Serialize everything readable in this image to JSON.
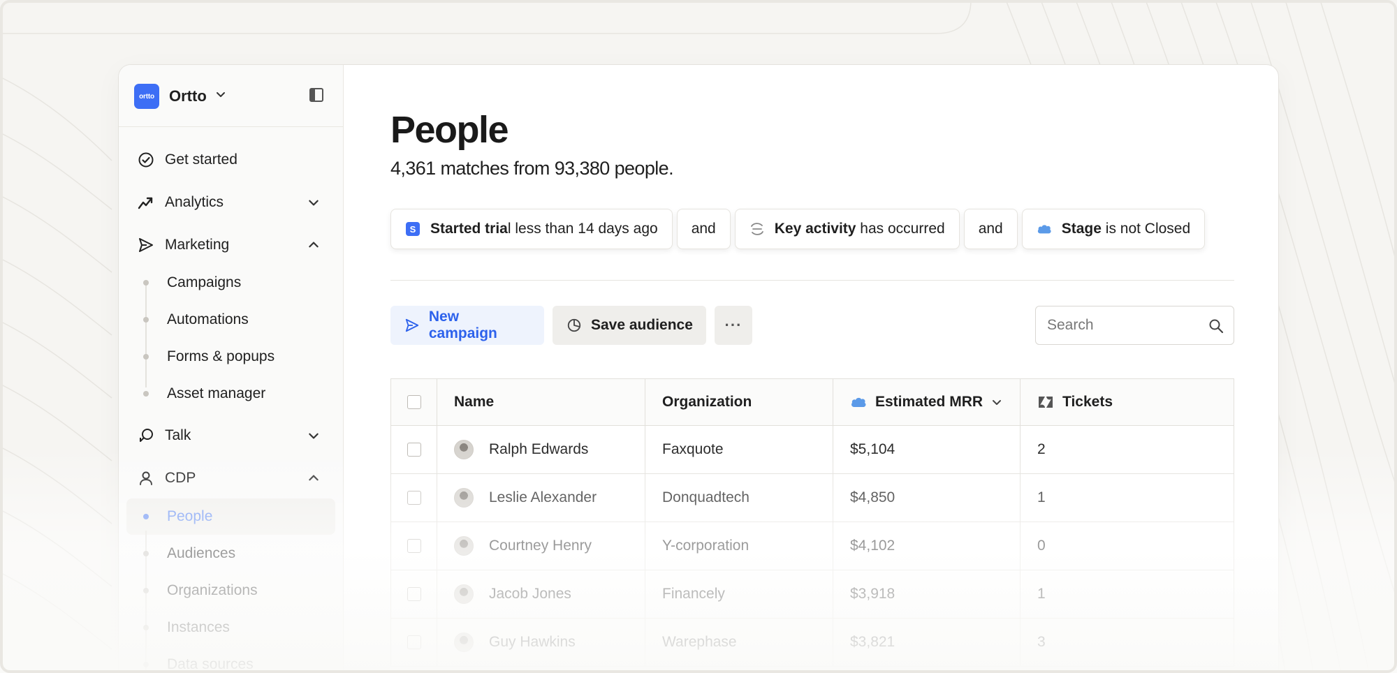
{
  "app": {
    "brand": "Ortto",
    "logo_text": "ortto",
    "accent": "#3d6ef5"
  },
  "sidebar": {
    "items": [
      {
        "label": "Get started",
        "icon": "check-circle-icon"
      },
      {
        "label": "Analytics",
        "icon": "trend-icon",
        "expanded": false
      },
      {
        "label": "Marketing",
        "icon": "send-icon",
        "expanded": true
      },
      {
        "label": "Talk",
        "icon": "chat-icon",
        "expanded": false
      },
      {
        "label": "CDP",
        "icon": "user-icon",
        "expanded": true
      }
    ],
    "marketing_sub": [
      "Campaigns",
      "Automations",
      "Forms & popups",
      "Asset manager"
    ],
    "cdp_sub": [
      "People",
      "Audiences",
      "Organizations",
      "Instances",
      "Data sources"
    ],
    "active_sub": "People"
  },
  "main": {
    "title": "People",
    "subtitle": "4,361 matches from 93,380 people.",
    "filters": {
      "f1_bold": "Started tria",
      "f1_rest": "l less than 14 days ago",
      "join1": "and",
      "f2_bold": "Key activity",
      "f2_rest": " has occurred",
      "join2": "and",
      "f3_bold": "Stage",
      "f3_rest": " is not Closed",
      "badge_letter": "S"
    },
    "toolbar": {
      "new_campaign": "New campaign",
      "save_audience": "Save audience",
      "more": "···",
      "search_placeholder": "Search"
    },
    "table": {
      "columns": [
        "Name",
        "Organization",
        "Estimated MRR",
        "Tickets"
      ],
      "rows": [
        {
          "name": "Ralph Edwards",
          "org": "Faxquote",
          "mrr": "$5,104",
          "tickets": "2"
        },
        {
          "name": "Leslie Alexander",
          "org": "Donquadtech",
          "mrr": "$4,850",
          "tickets": "1"
        },
        {
          "name": "Courtney Henry",
          "org": "Y-corporation",
          "mrr": "$4,102",
          "tickets": "0"
        },
        {
          "name": "Jacob Jones",
          "org": "Financely",
          "mrr": "$3,918",
          "tickets": "1"
        },
        {
          "name": "Guy Hawkins",
          "org": "Warephase",
          "mrr": "$3,821",
          "tickets": "3"
        }
      ]
    }
  }
}
